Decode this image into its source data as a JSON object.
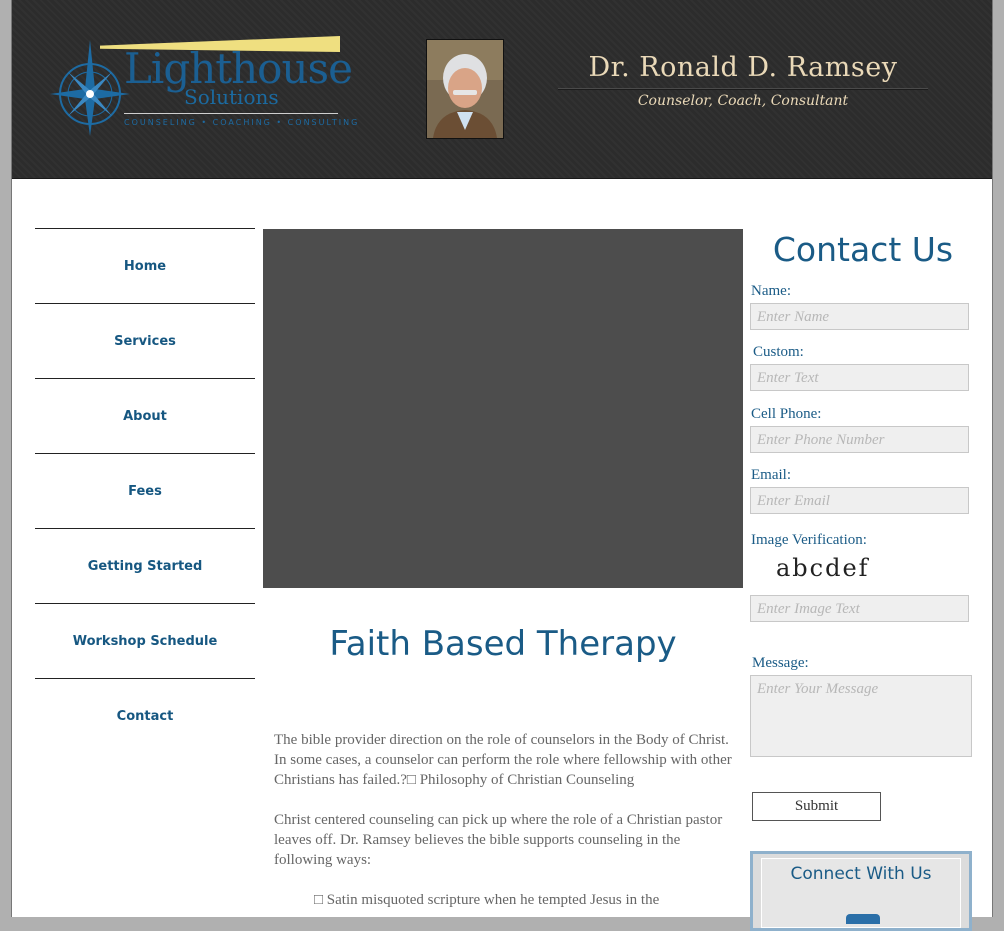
{
  "header": {
    "logo_word": "Lighthouse",
    "logo_sub": "Solutions",
    "logo_tagline": "COUNSELING • COACHING • CONSULTING",
    "doctor_name": "Dr. Ronald D. Ramsey",
    "doctor_tagline": "Counselor, Coach, Consultant"
  },
  "nav": {
    "items": [
      {
        "label": "Home"
      },
      {
        "label": "Services"
      },
      {
        "label": "About"
      },
      {
        "label": "Fees"
      },
      {
        "label": "Getting Started"
      },
      {
        "label": "Workshop Schedule"
      },
      {
        "label": "Contact"
      }
    ]
  },
  "main": {
    "title": "Faith Based Therapy",
    "paragraph1": "The bible provider direction on the role of counselors in the Body of Christ.  In some cases, a counselor can perform the role where fellowship with other Christians has failed.?□ Philosophy of Christian Counseling",
    "paragraph2": "Christ centered counseling can pick up where the role of a Christian pastor leaves off.  Dr. Ramsey believes the bible supports counseling in the following ways:",
    "paragraph3": "□ Satin misquoted scripture when he tempted Jesus in the"
  },
  "contact": {
    "title": "Contact Us",
    "name_label": "Name:",
    "name_placeholder": "Enter Name",
    "custom_label": "Custom:",
    "custom_placeholder": "Enter Text",
    "phone_label": "Cell Phone:",
    "phone_placeholder": "Enter Phone Number",
    "email_label": "Email:",
    "email_placeholder": "Enter Email",
    "verify_label": "Image Verification:",
    "captcha_text": "abcdef",
    "verify_placeholder": "Enter Image Text",
    "message_label": "Message:",
    "message_placeholder": "Enter Your Message",
    "submit_label": "Submit",
    "connect_title": "Connect With Us"
  },
  "colors": {
    "header_bg": "#2c2c2c",
    "brand_blue": "#1a5b86",
    "beam_yellow": "#efdf80",
    "cream_text": "#ead9b8",
    "slider_gray": "#4d4d4d"
  }
}
